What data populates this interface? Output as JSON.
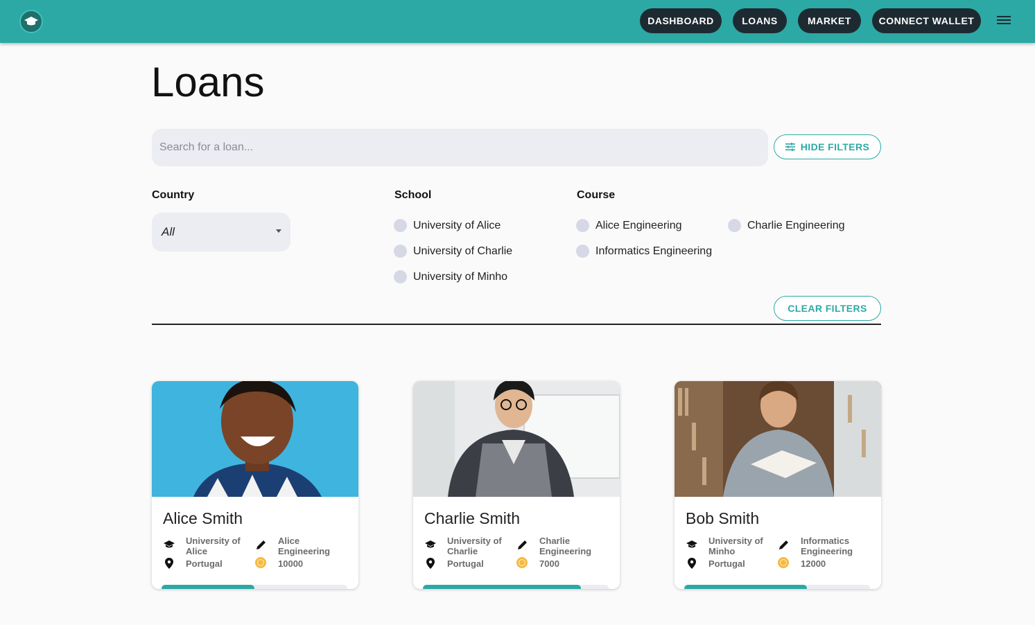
{
  "nav": {
    "dashboard": "DASHBOARD",
    "loans": "LOANS",
    "market": "MARKET",
    "connect_wallet": "CONNECT WALLET"
  },
  "page": {
    "title": "Loans"
  },
  "search": {
    "placeholder": "Search for a loan..."
  },
  "buttons": {
    "hide_filters": "HIDE FILTERS",
    "clear_filters": "CLEAR FILTERS"
  },
  "filters": {
    "country": {
      "heading": "Country",
      "selected": "All"
    },
    "school": {
      "heading": "School",
      "options": [
        "University of Alice",
        "University of Charlie",
        "University of Minho"
      ]
    },
    "course": {
      "heading": "Course",
      "options": [
        "Alice Engineering",
        "Charlie Engineering",
        "Informatics Engineering"
      ]
    }
  },
  "cards": [
    {
      "name": "Alice Smith",
      "school": "University of Alice",
      "course": "Alice Engineering",
      "country": "Portugal",
      "amount": "10000",
      "progress": 0.5
    },
    {
      "name": "Charlie Smith",
      "school": "University of Charlie",
      "course": "Charlie Engineering",
      "country": "Portugal",
      "amount": "7000",
      "progress": 0.85
    },
    {
      "name": "Bob Smith",
      "school": "University of Minho",
      "course": "Informatics Engineering",
      "country": "Portugal",
      "amount": "12000",
      "progress": 0.66
    }
  ],
  "colors": {
    "accent": "#2ca9a5",
    "nav_button": "#1e2a31",
    "coin": "#f5b942"
  }
}
